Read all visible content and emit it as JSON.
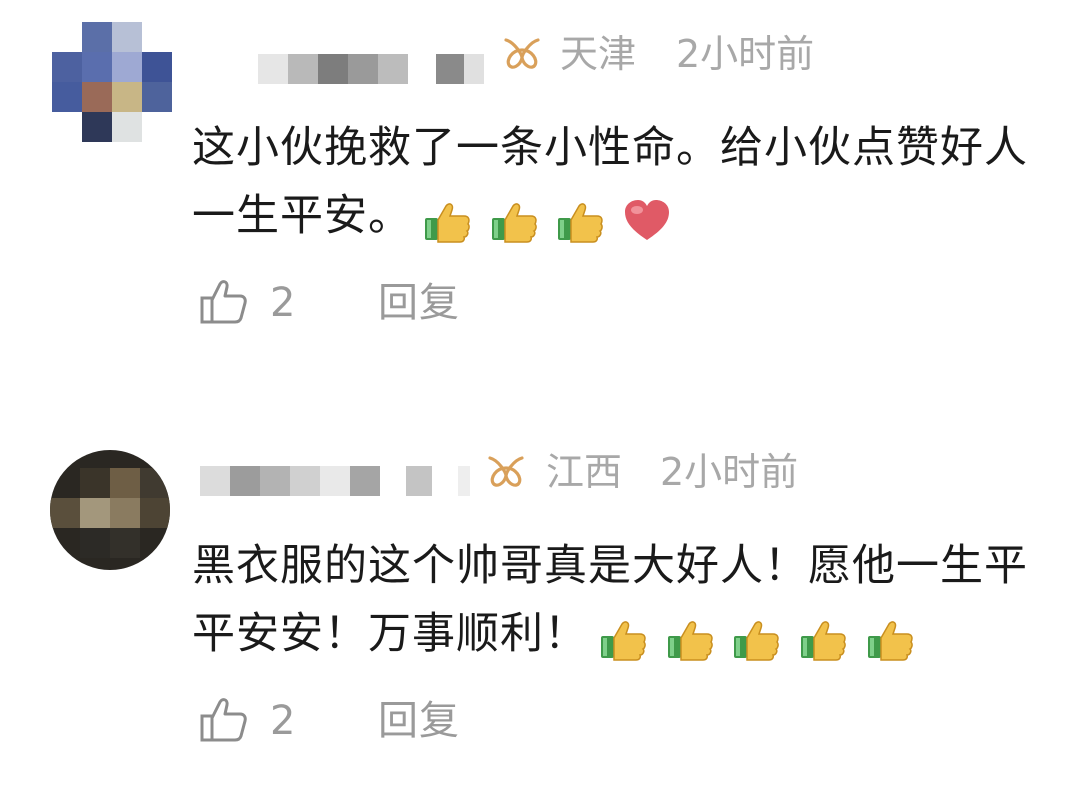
{
  "comments": [
    {
      "location": "天津",
      "time": "2小时前",
      "text": "这小伙挽救了一条小性命。给小伙点赞好人一生平安。",
      "emojis": [
        "thumbs-up",
        "thumbs-up",
        "thumbs-up",
        "red-heart"
      ],
      "like_count": "2",
      "reply_label": "回复"
    },
    {
      "location": "江西",
      "time": "2小时前",
      "text": "黑衣服的这个帅哥真是大好人！愿他一生平平安安！万事顺利！",
      "emojis": [
        "thumbs-up",
        "thumbs-up",
        "thumbs-up",
        "thumbs-up",
        "thumbs-up"
      ],
      "like_count": "2",
      "reply_label": "回复"
    }
  ],
  "colors": {
    "text_primary": "#1a1a1a",
    "text_secondary": "#a8a8a8",
    "badge_gold": "#d9a05a",
    "heart": "#e05a66",
    "thumb_yellow": "#f2c24b",
    "cuff_green": "#3f9a4a"
  }
}
